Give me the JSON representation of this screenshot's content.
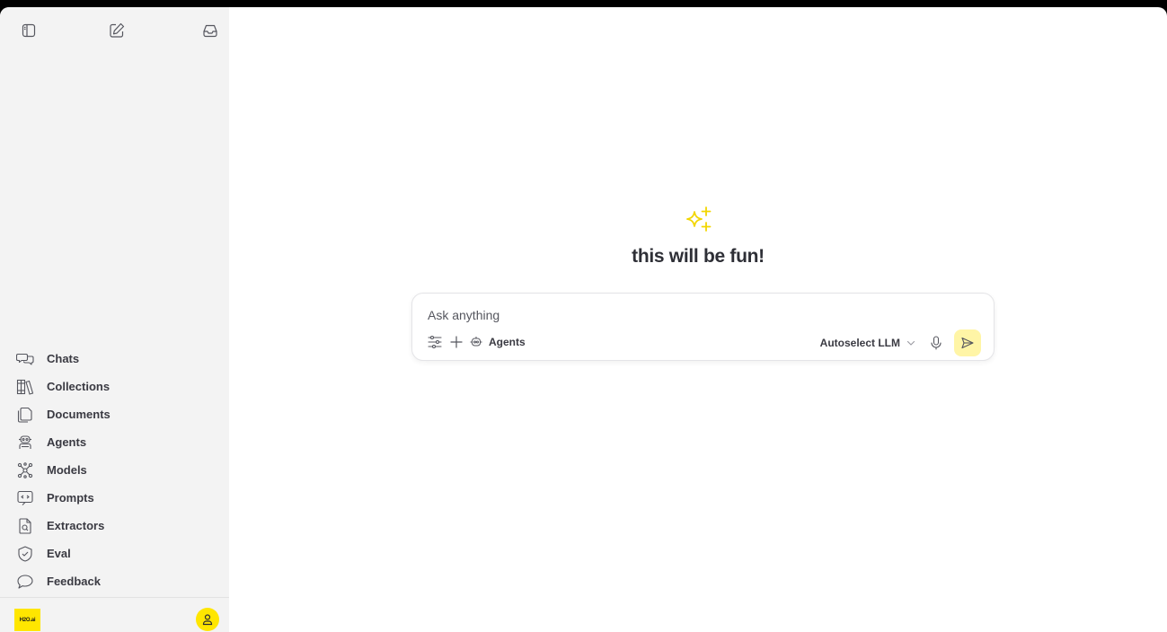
{
  "sidebar": {
    "top_buttons": [
      {
        "name": "toggle-sidebar",
        "icon": "sidebar-panel-icon"
      },
      {
        "name": "new-chat",
        "icon": "edit-icon"
      },
      {
        "name": "inbox",
        "icon": "inbox-icon"
      }
    ],
    "items": [
      {
        "label": "Chats",
        "icon": "chats-icon"
      },
      {
        "label": "Collections",
        "icon": "collections-icon"
      },
      {
        "label": "Documents",
        "icon": "documents-icon"
      },
      {
        "label": "Agents",
        "icon": "agents-icon"
      },
      {
        "label": "Models",
        "icon": "models-icon"
      },
      {
        "label": "Prompts",
        "icon": "prompts-icon"
      },
      {
        "label": "Extractors",
        "icon": "extractors-icon"
      },
      {
        "label": "Eval",
        "icon": "eval-icon"
      },
      {
        "label": "Feedback",
        "icon": "feedback-icon"
      }
    ],
    "logo_text": "H2O.ai"
  },
  "main": {
    "headline": "this will be fun!",
    "composer": {
      "placeholder": "Ask anything",
      "agents_label": "Agents",
      "model_label": "Autoselect LLM"
    }
  },
  "colors": {
    "accent": "#ffe600",
    "send_bg": "#fff5a6",
    "sidebar_bg": "#f3f3f3"
  }
}
